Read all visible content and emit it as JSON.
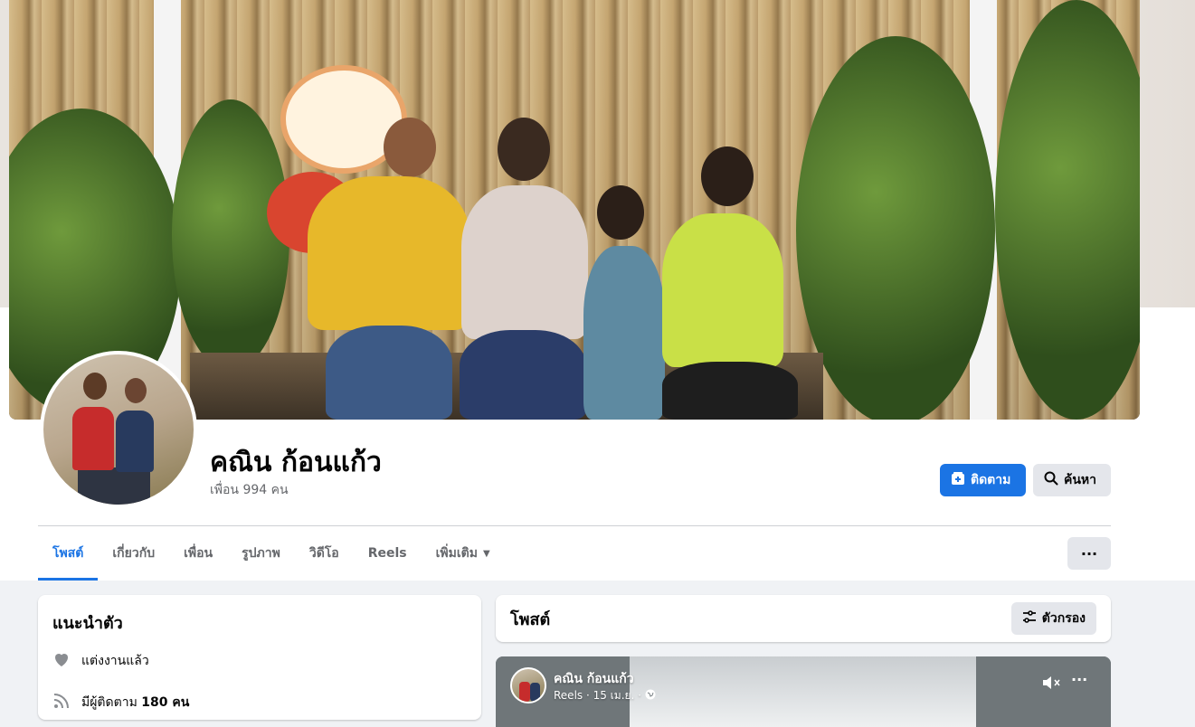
{
  "profile": {
    "name": "คณิน ก้อนแก้ว",
    "friends": "เพื่อน 994 คน"
  },
  "actions": {
    "follow": "ติดตาม",
    "search": "ค้นหา",
    "more": "···"
  },
  "tabs": [
    {
      "label": "โพสต์",
      "active": true
    },
    {
      "label": "เกี่ยวกับ"
    },
    {
      "label": "เพื่อน"
    },
    {
      "label": "รูปภาพ"
    },
    {
      "label": "วิดีโอ"
    },
    {
      "label": "Reels"
    },
    {
      "label": "เพิ่มเติม"
    }
  ],
  "intro": {
    "title": "แนะนำตัว",
    "relationship": "แต่งงานแล้ว",
    "followers_prefix": "มีผู้ติดตาม",
    "followers_count": "180 คน"
  },
  "posts": {
    "title": "โพสต์",
    "filter": "ตัวกรอง"
  },
  "reel": {
    "author": "คณิน ก้อนแก้ว",
    "meta": "Reels · 15 เม.ย. ·",
    "more": "···"
  },
  "colors": {
    "accent": "#1b74e4",
    "background": "#f0f2f5"
  }
}
